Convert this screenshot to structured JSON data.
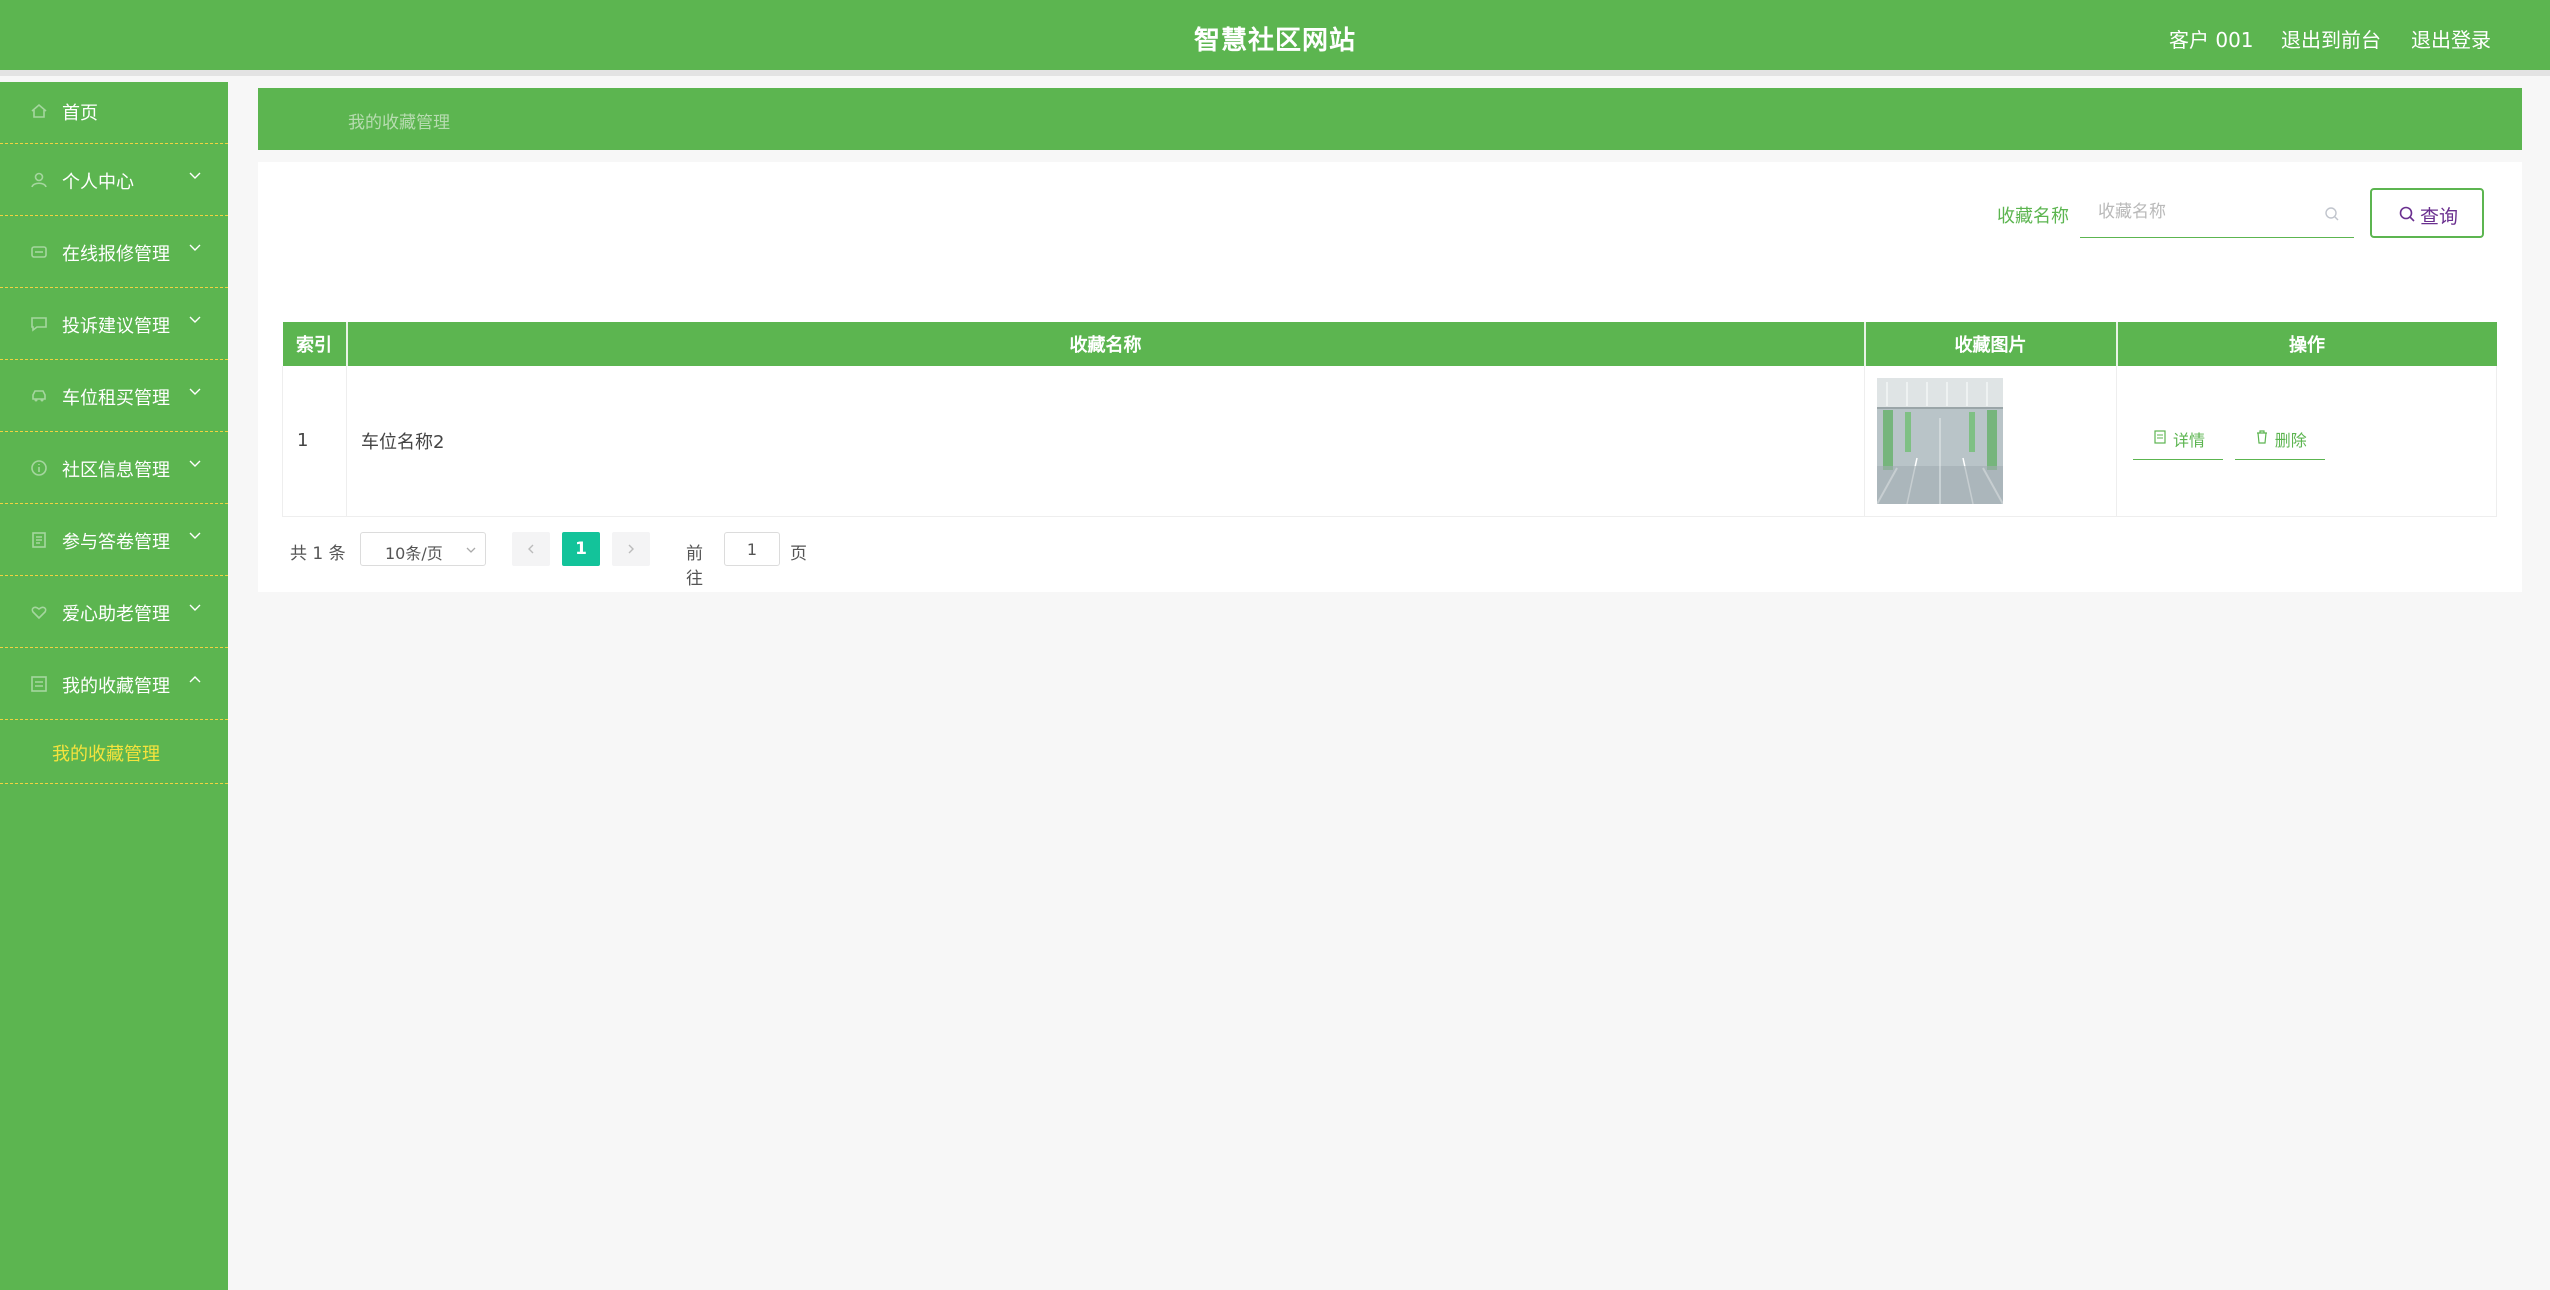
{
  "header": {
    "title": "智慧社区网站",
    "user": "客户 001",
    "back_to_front": "退出到前台",
    "logout": "退出登录"
  },
  "sidebar": {
    "items": [
      {
        "label": "首页",
        "icon": "home-icon"
      },
      {
        "label": "个人中心",
        "icon": "user-icon"
      },
      {
        "label": "在线报修管理",
        "icon": "wrench-icon"
      },
      {
        "label": "投诉建议管理",
        "icon": "comment-icon"
      },
      {
        "label": "车位租买管理",
        "icon": "car-icon"
      },
      {
        "label": "社区信息管理",
        "icon": "info-icon"
      },
      {
        "label": "参与答卷管理",
        "icon": "survey-icon"
      },
      {
        "label": "爱心助老管理",
        "icon": "heart-icon"
      },
      {
        "label": "我的收藏管理",
        "icon": "star-icon"
      }
    ],
    "submenu_active": "我的收藏管理"
  },
  "breadcrumb": "我的收藏管理",
  "search": {
    "label": "收藏名称",
    "placeholder": "收藏名称",
    "button": "查询"
  },
  "table": {
    "headers": [
      "索引",
      "收藏名称",
      "收藏图片",
      "操作"
    ],
    "rows": [
      {
        "index": "1",
        "name": "车位名称2",
        "image": "parking-garage-photo"
      }
    ],
    "actions": {
      "detail": "详情",
      "delete": "删除"
    }
  },
  "pagination": {
    "total": "共 1 条",
    "page_size": "10条/页",
    "current_page": "1",
    "goto_label": "前往",
    "goto_value": "1",
    "page_suffix": "页"
  },
  "colors": {
    "primary": "#5cb550",
    "active_page": "#13c39a",
    "submenu_text": "#f5e33d"
  }
}
